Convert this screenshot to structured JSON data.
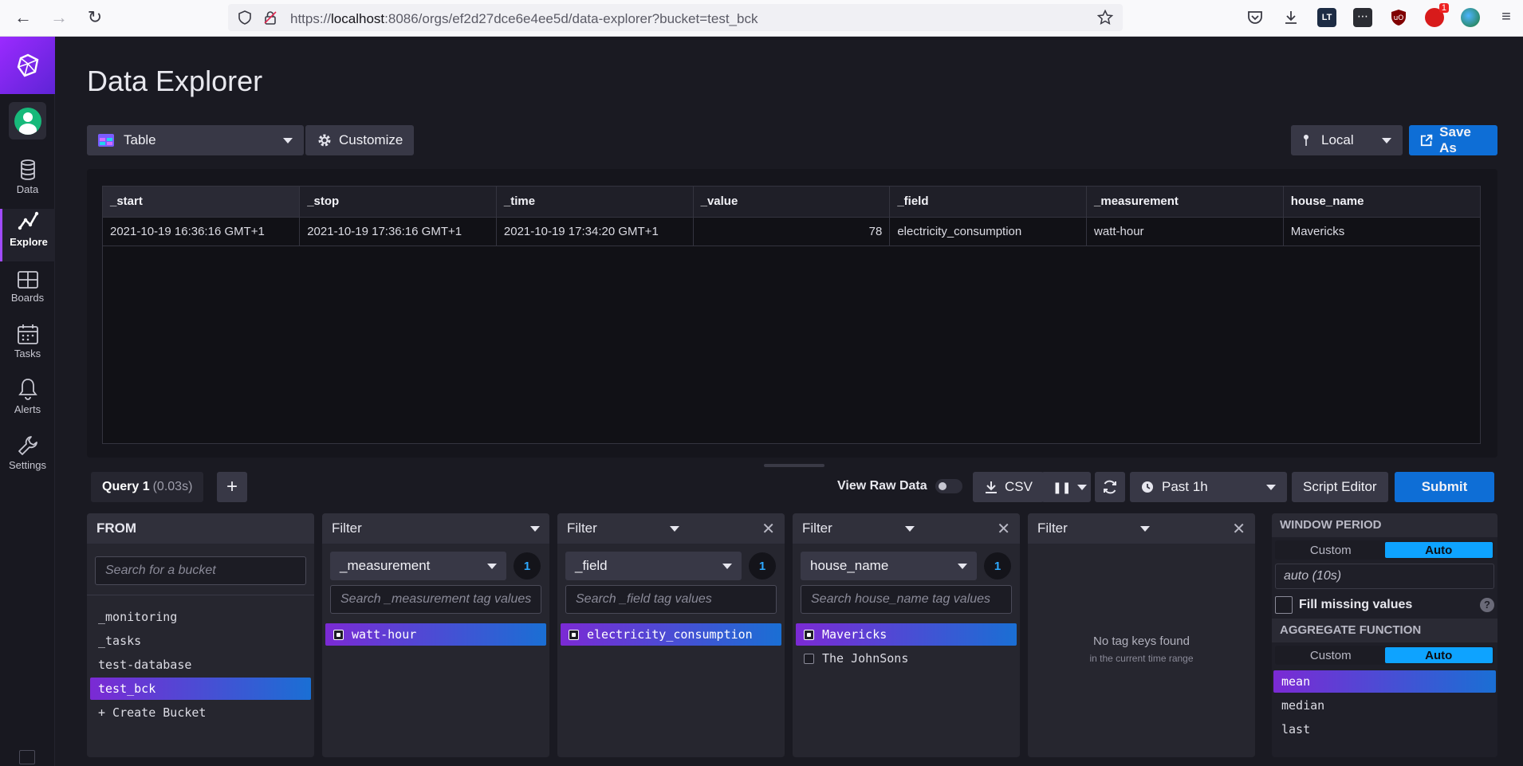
{
  "browser": {
    "url_prefix": "https://",
    "url_host": "localhost",
    "url_rest": ":8086/orgs/ef2d27dce6e4ee5d/data-explorer?bucket=test_bck",
    "badge_count": "1"
  },
  "sidebar": {
    "items": [
      {
        "label": "Data",
        "icon": "database-icon"
      },
      {
        "label": "Explore",
        "icon": "graph-icon"
      },
      {
        "label": "Boards",
        "icon": "dashboard-icon"
      },
      {
        "label": "Tasks",
        "icon": "calendar-icon"
      },
      {
        "label": "Alerts",
        "icon": "bell-icon"
      },
      {
        "label": "Settings",
        "icon": "wrench-icon"
      }
    ]
  },
  "header": {
    "title": "Data Explorer",
    "viz_type": "Table",
    "customize_label": "Customize",
    "timezone": "Local",
    "save_as_label": "Save As"
  },
  "table": {
    "columns": [
      "_start",
      "_stop",
      "_time",
      "_value",
      "_field",
      "_measurement",
      "house_name"
    ],
    "rows": [
      [
        "2021-10-19 16:36:16 GMT+1",
        "2021-10-19 17:36:16 GMT+1",
        "2021-10-19 17:34:20 GMT+1",
        "78",
        "electricity_consumption",
        "watt-hour",
        "Mavericks"
      ]
    ]
  },
  "query_bar": {
    "tab_name": "Query 1",
    "tab_time": "(0.03s)",
    "add_label": "+",
    "view_raw_label": "View Raw Data",
    "csv_label": "CSV",
    "time_range": "Past 1h",
    "script_editor_label": "Script Editor",
    "submit_label": "Submit"
  },
  "builder": {
    "from": {
      "title": "FROM",
      "search_placeholder": "Search for a bucket",
      "buckets": [
        "_monitoring",
        "_tasks",
        "test-database",
        "test_bck"
      ],
      "selected": "test_bck",
      "create_label": "+ Create Bucket"
    },
    "filters": [
      {
        "title": "Filter",
        "key": "_measurement",
        "count": "1",
        "placeholder": "Search _measurement tag values",
        "values": [
          {
            "label": "watt-hour",
            "selected": true
          }
        ]
      },
      {
        "title": "Filter",
        "key": "_field",
        "count": "1",
        "placeholder": "Search _field tag values",
        "values": [
          {
            "label": "electricity_consumption",
            "selected": true
          }
        ]
      },
      {
        "title": "Filter",
        "key": "house_name",
        "count": "1",
        "placeholder": "Search house_name tag values",
        "values": [
          {
            "label": "Mavericks",
            "selected": true
          },
          {
            "label": "The JohnSons",
            "selected": false
          }
        ]
      },
      {
        "title": "Filter",
        "empty_title": "No tag keys found",
        "empty_sub": "in the current time range"
      }
    ],
    "window": {
      "title": "WINDOW PERIOD",
      "custom_label": "Custom",
      "auto_label": "Auto",
      "value": "auto (10s)",
      "fill_label": "Fill missing values",
      "help": "?"
    },
    "aggregate": {
      "title": "AGGREGATE FUNCTION",
      "custom_label": "Custom",
      "auto_label": "Auto",
      "functions": [
        "mean",
        "median",
        "last"
      ],
      "selected": "mean"
    }
  }
}
